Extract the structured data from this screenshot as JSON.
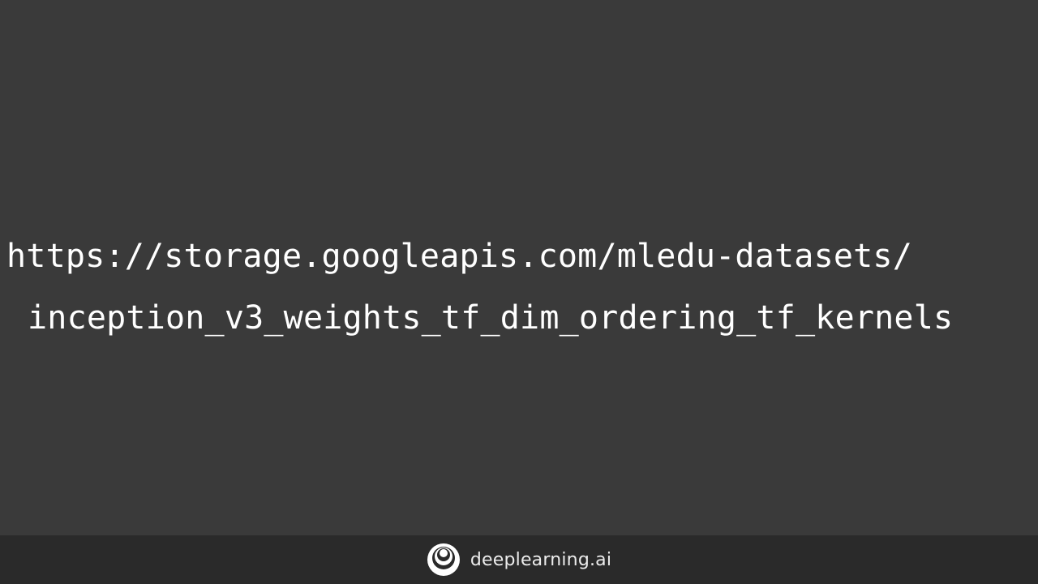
{
  "slide": {
    "url_line_1": "https://storage.googleapis.com/mledu-datasets/",
    "url_line_2": "inception_v3_weights_tf_dim_ordering_tf_kernels"
  },
  "footer": {
    "brand_name": "deeplearning.ai",
    "logo_icon": "deeplearning-logo-icon"
  },
  "colors": {
    "background": "#3a3a3a",
    "footer_background": "#2a2a2a",
    "text": "#ffffff"
  }
}
